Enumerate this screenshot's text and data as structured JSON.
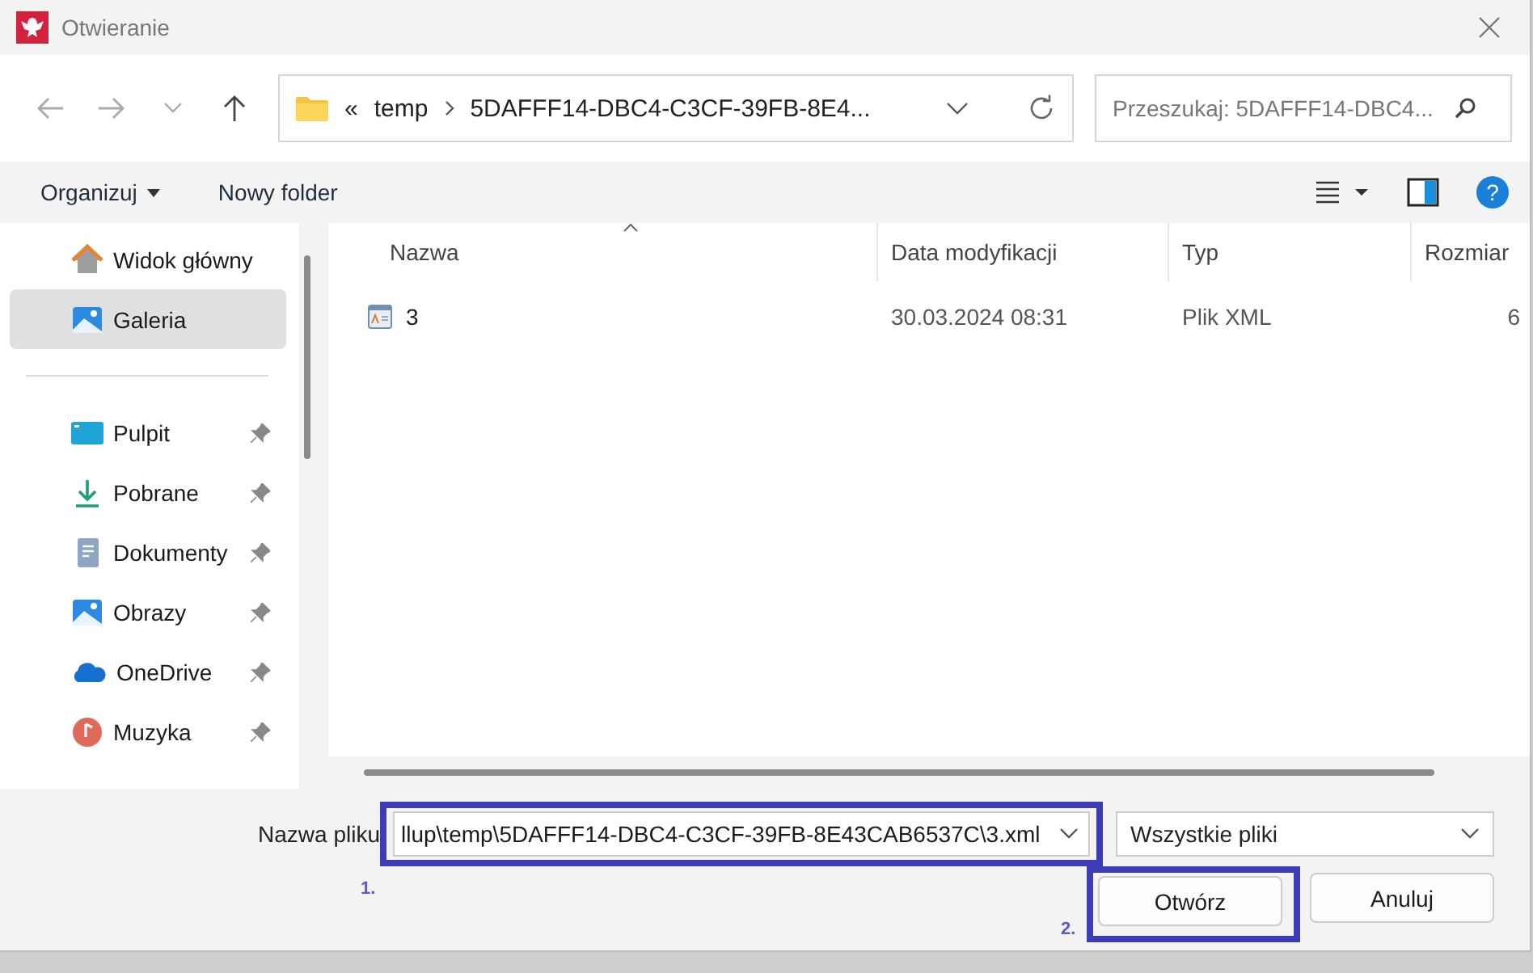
{
  "window": {
    "title": "Otwieranie"
  },
  "address_bar": {
    "overflow": "«",
    "path": [
      {
        "label": "temp"
      },
      {
        "label": "5DAFFF14-DBC4-C3CF-39FB-8E4..."
      }
    ]
  },
  "search": {
    "placeholder": "Przeszukaj: 5DAFFF14-DBC4..."
  },
  "toolbar": {
    "organize": "Organizuj",
    "new_folder": "Nowy folder",
    "help": "?"
  },
  "sidebar": {
    "items": [
      {
        "label": "Widok główny",
        "kind": "home",
        "selected": false,
        "pinned": false
      },
      {
        "label": "Galeria",
        "kind": "gallery",
        "selected": true,
        "pinned": false
      },
      {
        "kind": "separator"
      },
      {
        "label": "Pulpit",
        "kind": "desktop",
        "selected": false,
        "pinned": true
      },
      {
        "label": "Pobrane",
        "kind": "downloads",
        "selected": false,
        "pinned": true
      },
      {
        "label": "Dokumenty",
        "kind": "documents",
        "selected": false,
        "pinned": true
      },
      {
        "label": "Obrazy",
        "kind": "pictures",
        "selected": false,
        "pinned": true
      },
      {
        "label": "OneDrive",
        "kind": "cloud",
        "selected": false,
        "pinned": true
      },
      {
        "label": "Muzyka",
        "kind": "music",
        "selected": false,
        "pinned": true
      }
    ]
  },
  "table": {
    "columns": [
      "Nazwa",
      "Data modyfikacji",
      "Typ",
      "Rozmiar"
    ],
    "rows": [
      {
        "cells": [
          "3",
          "30.03.2024 08:31",
          "Plik XML",
          "6"
        ],
        "selected": false
      }
    ]
  },
  "footer": {
    "filename_label": "Nazwa pliku",
    "filename_value": "llup\\temp\\5DAFFF14-DBC4-C3CF-39FB-8E43CAB6537C\\3.xml",
    "file_type": "Wszystkie pliki",
    "open_button": "Otwórz",
    "cancel_button": "Anuluj"
  },
  "annotations": [
    {
      "label": "1."
    },
    {
      "label": "2."
    }
  ]
}
